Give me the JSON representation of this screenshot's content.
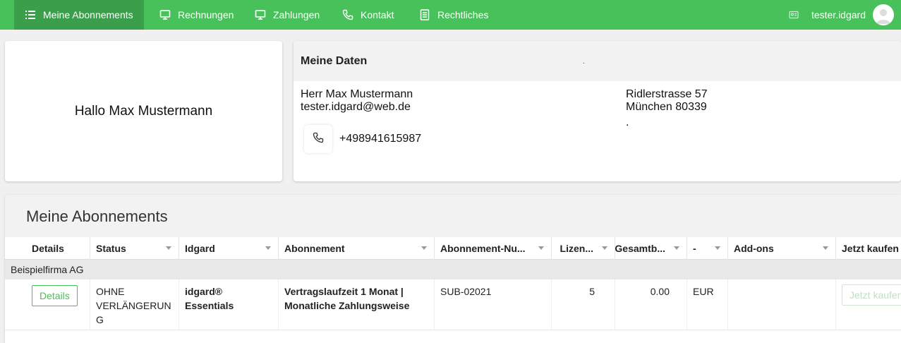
{
  "nav": {
    "items": [
      {
        "label": "Meine Abonnements",
        "icon": "list-icon",
        "active": true
      },
      {
        "label": "Rechnungen",
        "icon": "monitor-icon"
      },
      {
        "label": "Zahlungen",
        "icon": "monitor-icon"
      },
      {
        "label": "Kontakt",
        "icon": "phone-icon"
      },
      {
        "label": "Rechtliches",
        "icon": "document-icon"
      }
    ],
    "username": "tester.idgard"
  },
  "greeting": "Hallo Max Mustermann",
  "my_data": {
    "title": "Meine Daten",
    "name": "Herr Max Mustermann",
    "email": "tester.idgard@web.de",
    "phone": "+498941615987",
    "street": "Ridlerstrasse 57",
    "city": "München 80339",
    "extra": "."
  },
  "subscriptions": {
    "title": "Meine Abonnements",
    "columns": [
      "Details",
      "Status",
      "Idgard",
      "Abonnement",
      "Abonnement-Nu...",
      "Lizen...",
      "Gesamtb...",
      "-",
      "Add-ons",
      "Jetzt kaufen"
    ],
    "group": "Beispielfirma AG",
    "row": {
      "details_label": "Details",
      "status_lines": [
        "OHNE",
        "VERLÄNGERUN",
        "G"
      ],
      "idgard": "idgard® Essentials",
      "abo_lines": [
        "Vertragslaufzeit 1 Monat |",
        "Monatliche Zahlungsweise"
      ],
      "abo_number": "SUB-02021",
      "licenses": "5",
      "total": "0.00",
      "currency": "EUR",
      "addons": "",
      "buy_label": "Jetzt kaufen"
    }
  },
  "colors": {
    "brand_green": "#48c15a",
    "active_nav": "#3a9e4a"
  }
}
